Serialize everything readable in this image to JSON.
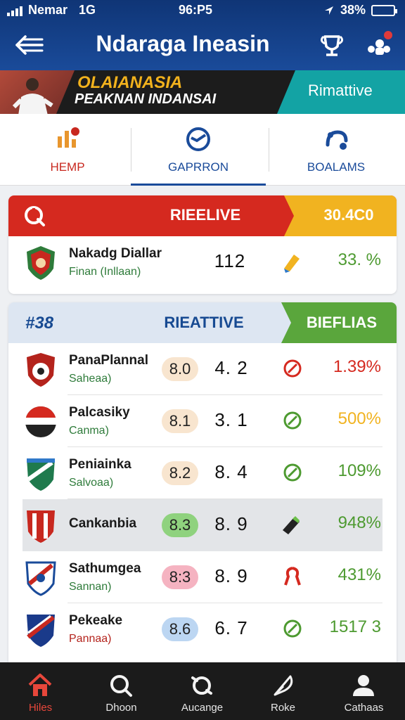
{
  "status_bar": {
    "carrier": "Nemar",
    "network": "1G",
    "time": "96:P5",
    "battery_pct": "38%",
    "battery_level": 0.38
  },
  "header": {
    "title": "Ndaraga Ineasin",
    "notification_count": ""
  },
  "banner": {
    "line1": "OLAIANASIA",
    "line2": "PEAKNAN INDANSAI",
    "right_text": "Rimattive"
  },
  "tabs": [
    {
      "label": "HEMP",
      "color": "#c8281f",
      "active": false
    },
    {
      "label": "GAPRRON",
      "color": "#1a4b9a",
      "active": true
    },
    {
      "label": "BOALAMS",
      "color": "#1a4b9a",
      "active": false
    }
  ],
  "featured": {
    "header_mid": "RIEELIVE",
    "header_value": "30.4C0",
    "row": {
      "name": "Nakadg Diallar",
      "sub": "Finan (Inllaan)",
      "number": "112",
      "percent": "33. %"
    }
  },
  "ranking": {
    "header_rank": "#38",
    "header_mid": "RIEATTIVE",
    "header_right": "BIEFLIAS",
    "rows": [
      {
        "name": "PanaPlannal",
        "sub": "Saheaa)",
        "score": "8.0",
        "number": "4. 2",
        "percent": "1.39%",
        "status": "down",
        "highlight": false
      },
      {
        "name": "Palcasiky",
        "sub": "Canma)",
        "score": "8.1",
        "number": "3. 1",
        "percent": "500%",
        "status": "up",
        "highlight": false
      },
      {
        "name": "Peniainka",
        "sub": "Salvoaa)",
        "score": "8.2",
        "number": "8. 4",
        "percent": "109%",
        "status": "up",
        "highlight": false
      },
      {
        "name": "Cankanbia",
        "sub": "",
        "score": "8.3",
        "number": "8. 9",
        "percent": "948%",
        "status": "marker",
        "highlight": true
      },
      {
        "name": "Sathumgea",
        "sub": "Sannan)",
        "score": "8:3",
        "number": "8. 9",
        "percent": "431%",
        "status": "ribbon",
        "highlight": false
      },
      {
        "name": "Pekeake",
        "sub": "Pannaa)",
        "score": "8.6",
        "number": "6. 7",
        "percent": "1517 3",
        "status": "up",
        "highlight": false
      }
    ]
  },
  "nav": [
    {
      "label": "Hiles",
      "icon": "home-icon",
      "active": true
    },
    {
      "label": "Dhoon",
      "icon": "search-icon",
      "active": false
    },
    {
      "label": "Aucange",
      "icon": "refresh-icon",
      "active": false
    },
    {
      "label": "Roke",
      "icon": "feather-icon",
      "active": false
    },
    {
      "label": "Cathaas",
      "icon": "user-icon",
      "active": false
    }
  ],
  "colors": {
    "primary": "#1a4b9a",
    "red": "#d5291f",
    "yellow": "#f1b320",
    "green": "#5aa63c"
  }
}
